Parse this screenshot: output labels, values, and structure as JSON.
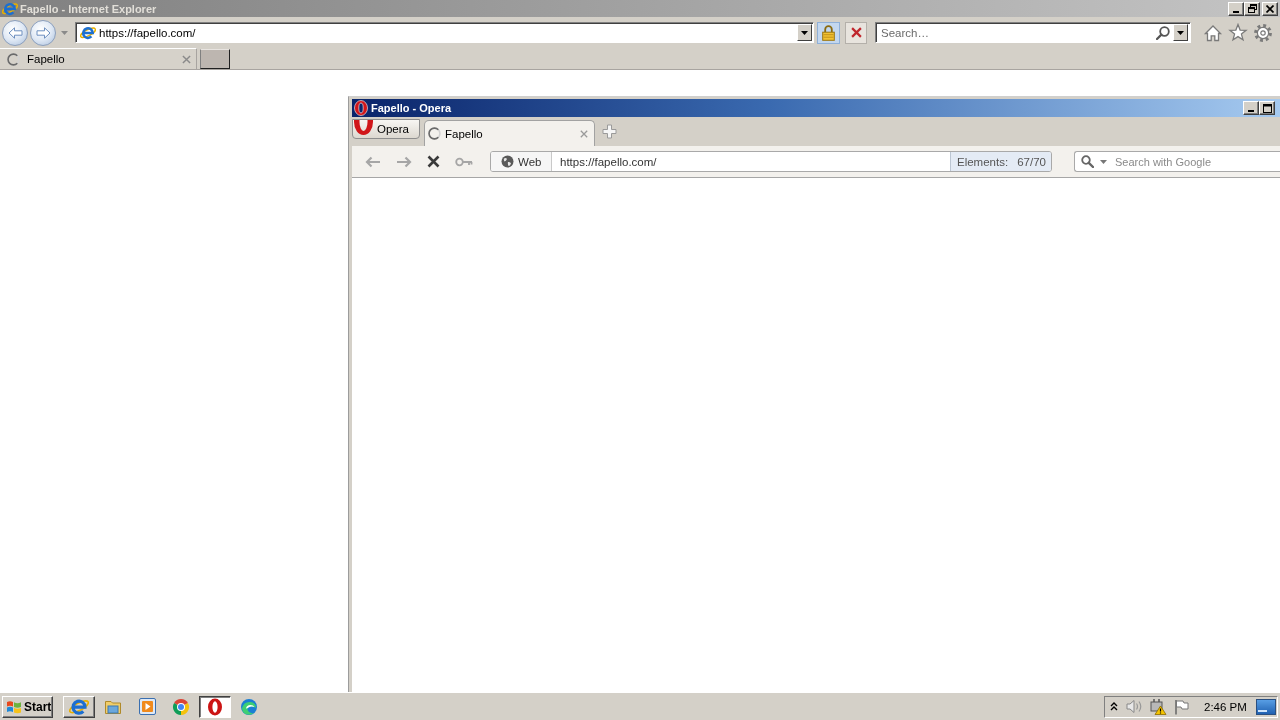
{
  "ie_window": {
    "title": "Fapello - Internet Explorer",
    "address": "https://fapello.com/",
    "search": {
      "placeholder": "Search…"
    },
    "tabs": [
      {
        "label": "Fapello",
        "selected": true,
        "loading": true
      }
    ]
  },
  "opera_window": {
    "title": "Fapello - Opera",
    "menu_button": "Opera",
    "tabs": [
      {
        "label": "Fapello",
        "selected": true,
        "loading": true
      }
    ],
    "nav_buttons": [
      {
        "kind": "back",
        "disabled": true
      },
      {
        "kind": "forward",
        "disabled": true
      },
      {
        "kind": "stop",
        "disabled": false
      },
      {
        "kind": "key",
        "disabled": true
      }
    ],
    "address_badge": "Web",
    "address": "https://fapello.com/",
    "elements": {
      "label": "Elements:",
      "count": "67/70"
    },
    "search": {
      "placeholder": "Search with Google"
    }
  },
  "taskbar": {
    "start_label": "Start",
    "apps": [
      {
        "kind": "ie",
        "running": true,
        "selected": false
      },
      {
        "kind": "folder",
        "running": false,
        "selected": false
      },
      {
        "kind": "media",
        "running": false,
        "selected": false
      },
      {
        "kind": "chrome",
        "running": false,
        "selected": false
      },
      {
        "kind": "opera",
        "running": true,
        "selected": true
      },
      {
        "kind": "edge",
        "running": false,
        "selected": false
      }
    ],
    "clock": "2:46 PM"
  }
}
